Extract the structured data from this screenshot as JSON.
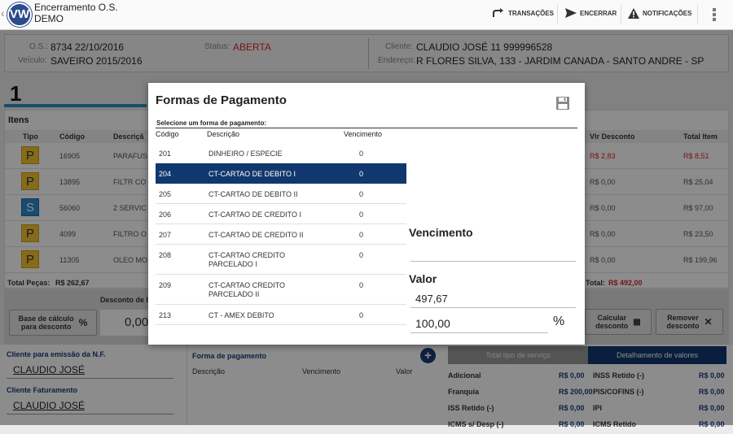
{
  "header": {
    "title": "Encerramento O.S.",
    "subtitle": "DEMO",
    "logo_text": "VW",
    "actions": [
      "TRANSAÇÕES",
      "ENCERRAR",
      "NOTIFICAÇÕES"
    ]
  },
  "os": {
    "os_label": "O.S.:",
    "os_value": "8734  22/10/2016",
    "veiculo_label": "Veículo:",
    "veiculo_value": "SAVEIRO  2015/2016",
    "status_label": "Status:",
    "status_value": "ABERTA",
    "cliente_label": "Cliente:",
    "cliente_value": "CLAUDIO JOSÉ 11 999996528",
    "endereco_label": "Endereço:",
    "endereco_value": "R FLORES SILVA, 133 - JARDIM CANADA - SANTO ANDRE - SP"
  },
  "tab_number": "1",
  "items": {
    "title": "Itens",
    "headers": {
      "tipo": "Tipo",
      "codigo": "Código",
      "descricao": "Descriçã",
      "vlr_desconto": "Vlr Desconto",
      "total_item": "Total Item"
    },
    "rows": [
      {
        "tipo": "P",
        "codigo": "16905",
        "descricao": "PARAFUS",
        "vlr_desconto": "R$ 2,83",
        "total": "R$ 8,51",
        "highlight": true
      },
      {
        "tipo": "P",
        "codigo": "13895",
        "descricao": "FILTR CO",
        "vlr_desconto": "R$ 0,00",
        "total": "R$ 25,04",
        "highlight": false
      },
      {
        "tipo": "S",
        "codigo": "56060",
        "descricao": "2 SERVIC",
        "vlr_desconto": "R$ 0,00",
        "total": "R$ 97,00",
        "highlight": false
      },
      {
        "tipo": "P",
        "codigo": "4099",
        "descricao": "FILTRO O",
        "vlr_desconto": "R$ 0,00",
        "total": "R$ 23,50",
        "highlight": false
      },
      {
        "tipo": "P",
        "codigo": "11305",
        "descricao": "OLEO MO",
        "vlr_desconto": "R$ 0,00",
        "total": "R$ 199,96",
        "highlight": false
      }
    ],
    "total_pecas_label": "Total Peças:",
    "total_pecas_value": "R$ 262,67",
    "total_label": "Total:",
    "total_value": "R$ 492,00"
  },
  "discount": {
    "desconto_label": "Desconto de I",
    "base_calc_label": "Base de cálculo\npara desconto",
    "desconto_value": "0,00",
    "calcular_label": "Calcular\ndesconto",
    "remover_label": "Remover\ndesconto"
  },
  "nf": {
    "cliente_nf_label": "Cliente para emissão da N.F.",
    "cliente_nf_value": "CLAUDIO JOSÉ",
    "cliente_fat_label": "Cliente Faturamento",
    "cliente_fat_value": "CLAUDIO JOSÉ"
  },
  "forma_pagamento_section": {
    "title": "Forma de pagamento",
    "descricao": "Descrição",
    "vencimento": "Vencimento",
    "valor": "Valor"
  },
  "summary": {
    "tab_total": "Total tipo de serviço",
    "tab_detalhe": "Detalhamento de valores",
    "rows": [
      {
        "l1": "Adicional",
        "v1": "R$ 0,00",
        "l2": "INSS Retido (-)",
        "v2": "R$ 0,00"
      },
      {
        "l1": "Franquia",
        "v1": "R$ 200,00",
        "l2": "PIS/COFINS (-)",
        "v2": "R$ 0,00"
      },
      {
        "l1": "ISS Retido (-)",
        "v1": "R$ 0,00",
        "l2": "IPI",
        "v2": "R$ 0,00"
      },
      {
        "l1": "ICMS s/ Desp (-)",
        "v1": "R$ 0,00",
        "l2": "ICMS Retido",
        "v2": "R$ 0,00"
      }
    ]
  },
  "modal": {
    "title": "Formas de Pagamento",
    "subtitle": "Selecione um forma de pagamento:",
    "col_codigo": "Código",
    "col_descricao": "Descrição",
    "col_vencimento": "Vencimento",
    "rows": [
      {
        "codigo": "201",
        "descricao": "DINHEIRO / ESPECIE",
        "vencimento": "0",
        "selected": false
      },
      {
        "codigo": "204",
        "descricao": "CT-CARTAO DE DEBITO I",
        "vencimento": "0",
        "selected": true
      },
      {
        "codigo": "205",
        "descricao": "CT-CARTAO DE DEBITO II",
        "vencimento": "0",
        "selected": false
      },
      {
        "codigo": "206",
        "descricao": "CT-CARTAO DE CREDITO I",
        "vencimento": "0",
        "selected": false
      },
      {
        "codigo": "207",
        "descricao": "CT-CARTAO DE CREDITO II",
        "vencimento": "0",
        "selected": false
      },
      {
        "codigo": "208",
        "descricao": "CT-CARTAO CREDITO\nPARCELADO I",
        "vencimento": "0",
        "selected": false
      },
      {
        "codigo": "209",
        "descricao": "CT-CARTAO CREDITO\nPARCELADO II",
        "vencimento": "0",
        "selected": false
      },
      {
        "codigo": "213",
        "descricao": "CT - AMEX DEBITO",
        "vencimento": "0",
        "selected": false
      }
    ],
    "vencimento_label": "Vencimento",
    "vencimento_value": "",
    "valor_label": "Valor",
    "valor_value": "497,67",
    "percent_value": "100,00",
    "percent_symbol": "%"
  },
  "colors": {
    "accent": "#10386e",
    "status_red": "#d9262b",
    "tab_blue": "#2a8fc7"
  }
}
